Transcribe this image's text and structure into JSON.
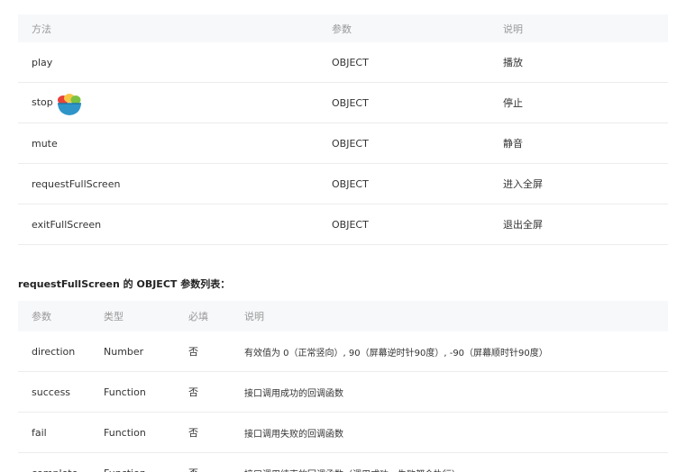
{
  "methods_table": {
    "headers": [
      "方法",
      "参数",
      "说明"
    ],
    "rows": [
      [
        "play",
        "OBJECT",
        "播放"
      ],
      [
        "stop",
        "OBJECT",
        "停止"
      ],
      [
        "mute",
        "OBJECT",
        "静音"
      ],
      [
        "requestFullScreen",
        "OBJECT",
        "进入全屏"
      ],
      [
        "exitFullScreen",
        "OBJECT",
        "退出全屏"
      ]
    ]
  },
  "section_title": "requestFullScreen 的 OBJECT 参数列表：",
  "params_table": {
    "headers": [
      "参数",
      "类型",
      "必填",
      "说明"
    ],
    "rows": [
      [
        "direction",
        "Number",
        "否",
        "有效值为 0（正常竖向）, 90（屏幕逆时针90度）, -90（屏幕顺时针90度）"
      ],
      [
        "success",
        "Function",
        "否",
        "接口调用成功的回调函数"
      ],
      [
        "fail",
        "Function",
        "否",
        "接口调用失败的回调函数"
      ],
      [
        "complete",
        "Function",
        "否",
        "接口调用结束的回调函数（调用成功、失败都会执行）"
      ]
    ]
  },
  "icons": {
    "emoji": "fruit-bowl-icon"
  }
}
